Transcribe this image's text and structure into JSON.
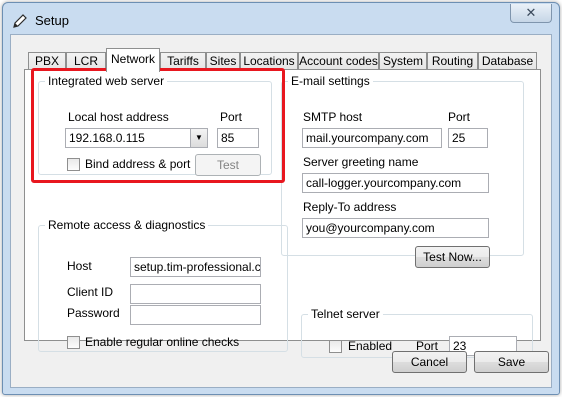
{
  "window": {
    "title": "Setup",
    "close_glyph": "✕"
  },
  "tabs": [
    "PBX",
    "LCR",
    "Network",
    "Tariffs",
    "Sites",
    "Locations",
    "Account codes",
    "System",
    "Routing",
    "Database"
  ],
  "active_tab": "Network",
  "web_server": {
    "legend": "Integrated web server",
    "host_label": "Local host address",
    "host_value": "192.168.0.115",
    "port_label": "Port",
    "port_value": "85",
    "bind_label": "Bind address & port",
    "bind_checked": false,
    "test_label": "Test"
  },
  "remote": {
    "legend": "Remote access & diagnostics",
    "host_label": "Host",
    "host_value": "setup.tim-professional.com",
    "client_label": "Client ID",
    "client_value": "",
    "password_label": "Password",
    "password_value": "",
    "checks_label": "Enable regular online checks",
    "checks_checked": false
  },
  "email": {
    "legend": "E-mail settings",
    "smtp_label": "SMTP host",
    "smtp_value": "mail.yourcompany.com",
    "port_label": "Port",
    "port_value": "25",
    "greeting_label": "Server greeting name",
    "greeting_value": "call-logger.yourcompany.com",
    "reply_label": "Reply-To address",
    "reply_value": "you@yourcompany.com",
    "test_now_label": "Test Now..."
  },
  "telnet": {
    "legend": "Telnet server",
    "enabled_label": "Enabled",
    "enabled_checked": false,
    "port_label": "Port",
    "port_value": "23"
  },
  "footer": {
    "cancel_label": "Cancel",
    "save_label": "Save"
  },
  "colors": {
    "highlight": "#e8171f",
    "frame": "#c9dcf0"
  }
}
